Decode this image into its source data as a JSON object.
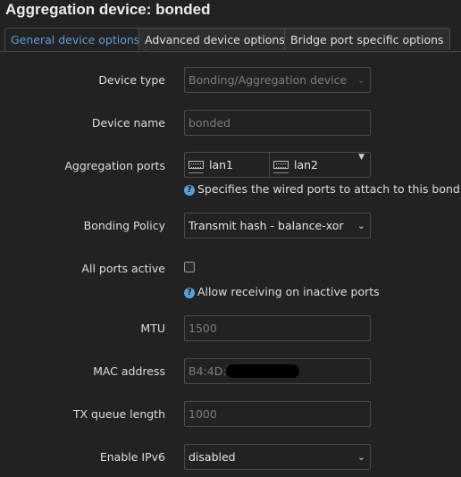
{
  "title": "Aggregation device: bonded",
  "tabs": [
    {
      "label": "General device options",
      "active": true
    },
    {
      "label": "Advanced device options",
      "active": false
    },
    {
      "label": "Bridge port specific options",
      "active": false
    }
  ],
  "form": {
    "device_type": {
      "label": "Device type",
      "value": "Bonding/Aggregation device"
    },
    "device_name": {
      "label": "Device name",
      "placeholder": "bonded"
    },
    "aggregation_ports": {
      "label": "Aggregation ports",
      "ports": [
        "lan1",
        "lan2"
      ],
      "help": "Specifies the wired ports to attach to this bonding."
    },
    "bonding_policy": {
      "label": "Bonding Policy",
      "value": "Transmit hash - balance-xor"
    },
    "all_ports_active": {
      "label": "All ports active",
      "checked": false,
      "help": "Allow receiving on inactive ports"
    },
    "mtu": {
      "label": "MTU",
      "placeholder": "1500"
    },
    "mac_address": {
      "label": "MAC address",
      "value": "B4:4D:"
    },
    "tx_queue_length": {
      "label": "TX queue length",
      "placeholder": "1000"
    },
    "enable_ipv6": {
      "label": "Enable IPv6",
      "value": "disabled"
    }
  },
  "icons": {
    "help": "question-circle-icon",
    "port": "ethernet-port-icon",
    "dropdown": "chevron-down-icon"
  },
  "colors": {
    "accent": "#5e9ed6",
    "background": "#222222",
    "border": "#4a4a4a"
  }
}
